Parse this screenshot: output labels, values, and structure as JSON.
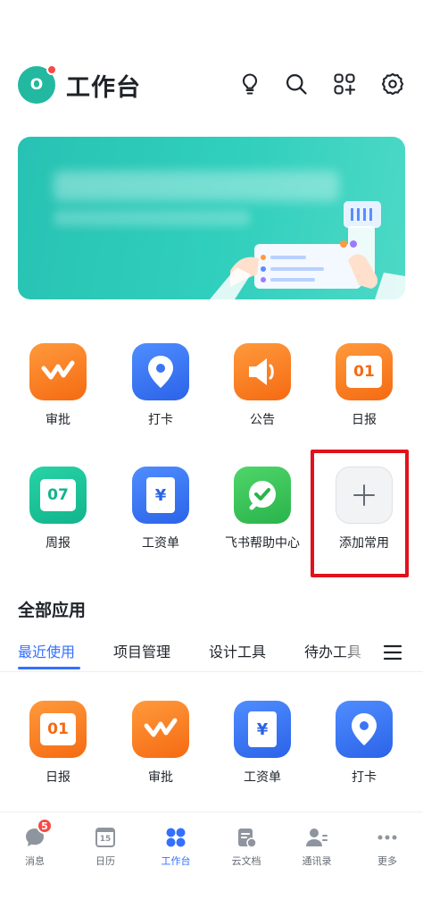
{
  "header": {
    "avatar_initial": "O",
    "title": "工作台"
  },
  "apps": [
    {
      "label": "审批",
      "color": "orange"
    },
    {
      "label": "打卡",
      "color": "blue"
    },
    {
      "label": "公告",
      "color": "orange"
    },
    {
      "label": "日报",
      "color": "orange",
      "tile_text": "01"
    },
    {
      "label": "周报",
      "color": "green",
      "tile_text": "07"
    },
    {
      "label": "工资单",
      "color": "blue",
      "tile_text": "¥"
    },
    {
      "label": "飞书帮助中心",
      "color": "lime"
    },
    {
      "label": "添加常用",
      "color": "grey"
    }
  ],
  "all_apps": {
    "title": "全部应用",
    "tabs": [
      "最近使用",
      "项目管理",
      "设计工具",
      "待办工具"
    ],
    "active_tab": "最近使用"
  },
  "recent_apps": [
    {
      "label": "日报",
      "tile_text": "01"
    },
    {
      "label": "审批"
    },
    {
      "label": "工资单",
      "tile_text": "¥"
    },
    {
      "label": "打卡"
    }
  ],
  "bottom_nav": {
    "items": [
      {
        "label": "消息",
        "badge": "5"
      },
      {
        "label": "日历",
        "icon_text": "15"
      },
      {
        "label": "工作台"
      },
      {
        "label": "云文档"
      },
      {
        "label": "通讯录"
      },
      {
        "label": "更多"
      }
    ],
    "active": "工作台"
  },
  "colors": {
    "accent": "#3370ff",
    "highlight_border": "#e0121b",
    "badge": "#f54a45"
  }
}
